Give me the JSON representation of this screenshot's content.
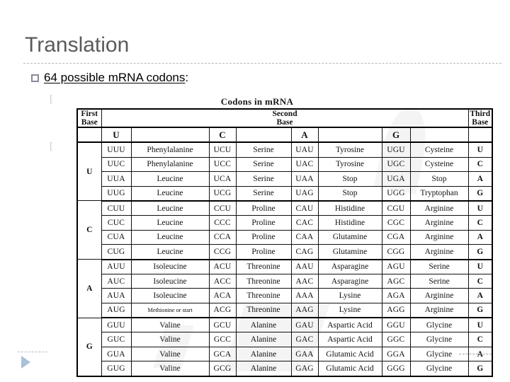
{
  "slide": {
    "title": "Translation",
    "bullet": {
      "marker": "square-bullet",
      "underlined_text": "64 possible mRNA codons",
      "trailing_text": ":"
    },
    "sub_bullet_marker": "[",
    "footer_icon": "play-triangle-icon"
  },
  "figure": {
    "caption": "Codons in mRNA",
    "headers": {
      "first_base": "First\nBase",
      "first_base_line1": "First",
      "first_base_line2": "Base",
      "second_base_line1": "Second",
      "second_base_line2": "Base",
      "third_base_line1": "Third",
      "third_base_line2": "Base",
      "second_columns": [
        "U",
        "C",
        "A",
        "G"
      ]
    },
    "blocks": [
      {
        "first_base": "U",
        "rows": [
          {
            "third_base": "U",
            "cells": [
              {
                "codon": "UUU",
                "amino": "Phenylalanine"
              },
              {
                "codon": "UCU",
                "amino": "Serine"
              },
              {
                "codon": "UAU",
                "amino": "Tyrosine"
              },
              {
                "codon": "UGU",
                "amino": "Cysteine"
              }
            ]
          },
          {
            "third_base": "C",
            "cells": [
              {
                "codon": "UUC",
                "amino": "Phenylalanine"
              },
              {
                "codon": "UCC",
                "amino": "Serine"
              },
              {
                "codon": "UAC",
                "amino": "Tyrosine"
              },
              {
                "codon": "UGC",
                "amino": "Cysteine"
              }
            ]
          },
          {
            "third_base": "A",
            "cells": [
              {
                "codon": "UUA",
                "amino": "Leucine"
              },
              {
                "codon": "UCA",
                "amino": "Serine"
              },
              {
                "codon": "UAA",
                "amino": "Stop"
              },
              {
                "codon": "UGA",
                "amino": "Stop"
              }
            ]
          },
          {
            "third_base": "G",
            "cells": [
              {
                "codon": "UUG",
                "amino": "Leucine"
              },
              {
                "codon": "UCG",
                "amino": "Serine"
              },
              {
                "codon": "UAG",
                "amino": "Stop"
              },
              {
                "codon": "UGG",
                "amino": "Tryptophan"
              }
            ]
          }
        ]
      },
      {
        "first_base": "C",
        "rows": [
          {
            "third_base": "U",
            "cells": [
              {
                "codon": "CUU",
                "amino": "Leucine"
              },
              {
                "codon": "CCU",
                "amino": "Proline"
              },
              {
                "codon": "CAU",
                "amino": "Histidine"
              },
              {
                "codon": "CGU",
                "amino": "Arginine"
              }
            ]
          },
          {
            "third_base": "C",
            "cells": [
              {
                "codon": "CUC",
                "amino": "Leucine"
              },
              {
                "codon": "CCC",
                "amino": "Proline"
              },
              {
                "codon": "CAC",
                "amino": "Histidine"
              },
              {
                "codon": "CGC",
                "amino": "Arginine"
              }
            ]
          },
          {
            "third_base": "A",
            "cells": [
              {
                "codon": "CUA",
                "amino": "Leucine"
              },
              {
                "codon": "CCA",
                "amino": "Proline"
              },
              {
                "codon": "CAA",
                "amino": "Glutamine"
              },
              {
                "codon": "CGA",
                "amino": "Arginine"
              }
            ]
          },
          {
            "third_base": "G",
            "cells": [
              {
                "codon": "CUG",
                "amino": "Leucine"
              },
              {
                "codon": "CCG",
                "amino": "Proline"
              },
              {
                "codon": "CAG",
                "amino": "Glutamine"
              },
              {
                "codon": "CGG",
                "amino": "Arginine"
              }
            ]
          }
        ]
      },
      {
        "first_base": "A",
        "rows": [
          {
            "third_base": "U",
            "cells": [
              {
                "codon": "AUU",
                "amino": "Isoleucine"
              },
              {
                "codon": "ACU",
                "amino": "Threonine"
              },
              {
                "codon": "AAU",
                "amino": "Asparagine"
              },
              {
                "codon": "AGU",
                "amino": "Serine"
              }
            ]
          },
          {
            "third_base": "C",
            "cells": [
              {
                "codon": "AUC",
                "amino": "Isoleucine"
              },
              {
                "codon": "ACC",
                "amino": "Threonine"
              },
              {
                "codon": "AAC",
                "amino": "Asparagine"
              },
              {
                "codon": "AGC",
                "amino": "Serine"
              }
            ]
          },
          {
            "third_base": "A",
            "cells": [
              {
                "codon": "AUA",
                "amino": "Isoleucine"
              },
              {
                "codon": "ACA",
                "amino": "Threonine"
              },
              {
                "codon": "AAA",
                "amino": "Lysine"
              },
              {
                "codon": "AGA",
                "amino": "Arginine"
              }
            ]
          },
          {
            "third_base": "G",
            "cells": [
              {
                "codon": "AUG",
                "amino": "Methionine or start",
                "small": true
              },
              {
                "codon": "ACG",
                "amino": "Threonine"
              },
              {
                "codon": "AAG",
                "amino": "Lysine"
              },
              {
                "codon": "AGG",
                "amino": "Arginine"
              }
            ]
          }
        ]
      },
      {
        "first_base": "G",
        "rows": [
          {
            "third_base": "U",
            "cells": [
              {
                "codon": "GUU",
                "amino": "Valine"
              },
              {
                "codon": "GCU",
                "amino": "Alanine"
              },
              {
                "codon": "GAU",
                "amino": "Aspartic Acid"
              },
              {
                "codon": "GGU",
                "amino": "Glycine"
              }
            ]
          },
          {
            "third_base": "C",
            "cells": [
              {
                "codon": "GUC",
                "amino": "Valine"
              },
              {
                "codon": "GCC",
                "amino": "Alanine"
              },
              {
                "codon": "GAC",
                "amino": "Aspartic Acid"
              },
              {
                "codon": "GGC",
                "amino": "Glycine"
              }
            ]
          },
          {
            "third_base": "A",
            "cells": [
              {
                "codon": "GUA",
                "amino": "Valine"
              },
              {
                "codon": "GCA",
                "amino": "Alanine"
              },
              {
                "codon": "GAA",
                "amino": "Glutamic Acid"
              },
              {
                "codon": "GGA",
                "amino": "Glycine"
              }
            ]
          },
          {
            "third_base": "G",
            "cells": [
              {
                "codon": "GUG",
                "amino": "Valine"
              },
              {
                "codon": "GCG",
                "amino": "Alanine"
              },
              {
                "codon": "GAG",
                "amino": "Glutamic Acid"
              },
              {
                "codon": "GGG",
                "amino": "Glycine"
              }
            ]
          }
        ]
      }
    ]
  },
  "colors": {
    "title": "#5a5a5a",
    "rule": "#b8b8b8",
    "bullet_square_border": "#8a8a99",
    "table_line": "#111111",
    "play_triangle": "#aac2d8"
  }
}
